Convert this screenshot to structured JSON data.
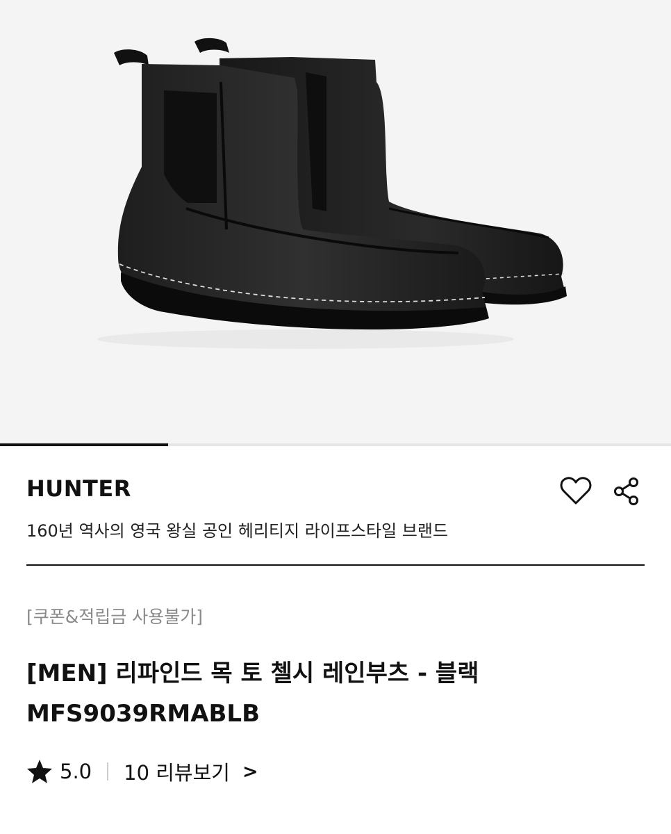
{
  "gallery": {
    "progress": 0.25,
    "background": "#f4f4f4"
  },
  "product": {
    "brand": "HUNTER",
    "brand_description": "160년 역사의 영국 왕실 공인 헤리티지 라이프스타일 브랜드",
    "notice": "[쿠폰&적립금 사용불가]",
    "title_line1": "[MEN] 리파인드 목 토 첼시 레인부츠 - 블랙",
    "title_line2": "MFS9039RMABLB",
    "rating": "5.0",
    "review_link": "10 리뷰보기",
    "review_chevron": ">"
  },
  "icons": {
    "wishlist": "heart-icon",
    "share": "share-icon",
    "rating": "star-icon"
  }
}
